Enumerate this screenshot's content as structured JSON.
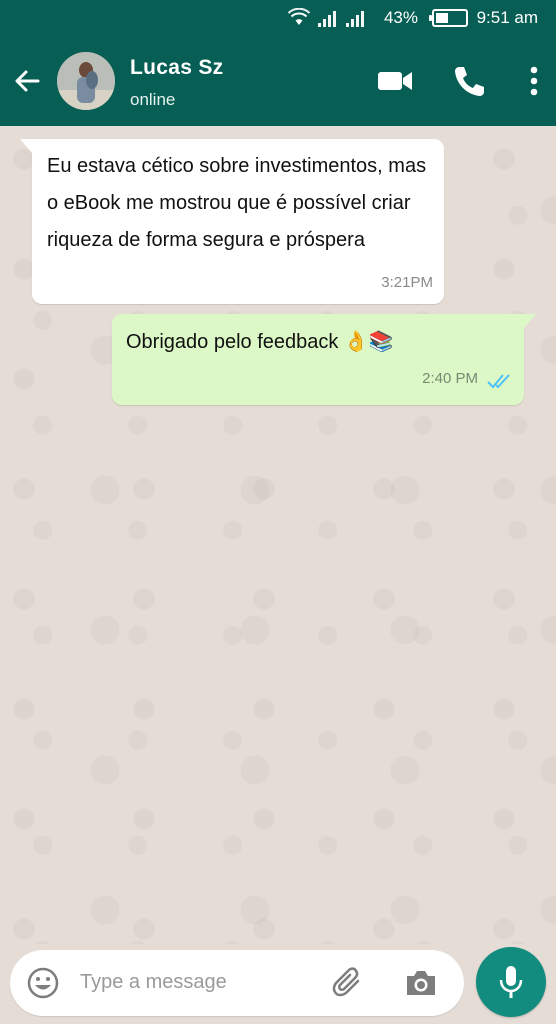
{
  "status_bar": {
    "battery_percent": "43%",
    "time": "9:51 am",
    "battery_level": 0.43,
    "icons": [
      "wifi-icon",
      "signal-icon",
      "signal-icon",
      "battery-icon"
    ]
  },
  "header": {
    "contact_name": "Lucas Sz",
    "presence": "online",
    "icons": [
      "back-arrow-icon",
      "video-call-icon",
      "phone-call-icon",
      "more-options-icon"
    ]
  },
  "messages": [
    {
      "direction": "incoming",
      "text": "Eu estava cético sobre investimentos, mas o eBook me mostrou que é possível criar riqueza de forma segura e próspera",
      "time": "3:21PM"
    },
    {
      "direction": "outgoing",
      "text": "Obrigado pelo feedback 👌📚",
      "time": "2:40 PM",
      "status": "read"
    }
  ],
  "input": {
    "placeholder": "Type a message",
    "icons": [
      "emoji-icon",
      "attach-icon",
      "camera-icon",
      "mic-icon"
    ]
  },
  "colors": {
    "header": "#075e54",
    "outgoing_bubble": "#dcf8c6",
    "incoming_bubble": "#ffffff",
    "mic_button": "#128c7e",
    "read_ticks": "#4fc3f7"
  }
}
